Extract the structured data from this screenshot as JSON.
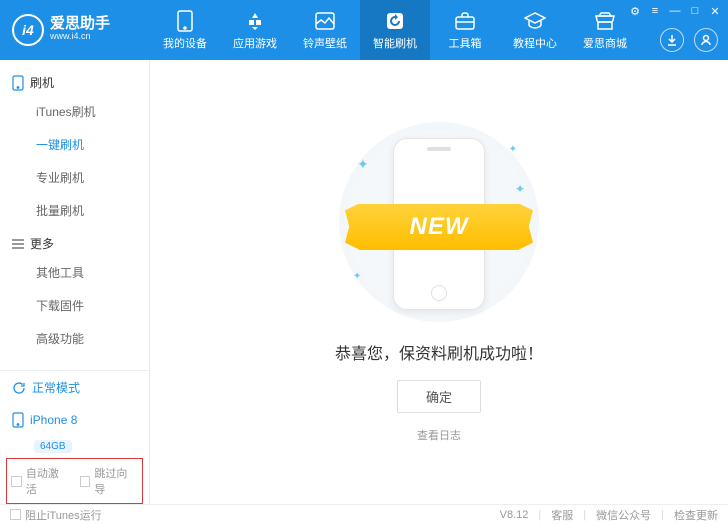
{
  "header": {
    "logo_badge": "i4",
    "logo_cn": "爱思助手",
    "logo_en": "www.i4.cn",
    "nav": [
      {
        "label": "我的设备"
      },
      {
        "label": "应用游戏"
      },
      {
        "label": "铃声壁纸"
      },
      {
        "label": "智能刷机"
      },
      {
        "label": "工具箱"
      },
      {
        "label": "教程中心"
      },
      {
        "label": "爱思商城"
      }
    ]
  },
  "sidebar": {
    "group1": {
      "title": "刷机",
      "items": [
        "iTunes刷机",
        "一键刷机",
        "专业刷机",
        "批量刷机"
      ]
    },
    "group2": {
      "title": "更多",
      "items": [
        "其他工具",
        "下载固件",
        "高级功能"
      ]
    },
    "mode": "正常模式",
    "device": "iPhone 8",
    "device_badge": "64GB",
    "auto_activate": "自动激活",
    "skip_wizard": "跳过向导"
  },
  "content": {
    "banner_text": "NEW",
    "message": "恭喜您，保资料刷机成功啦！",
    "ok": "确定",
    "log": "查看日志"
  },
  "footer": {
    "block_itunes": "阻止iTunes运行",
    "version": "V8.12",
    "service": "客服",
    "wechat": "微信公众号",
    "update": "检查更新"
  }
}
